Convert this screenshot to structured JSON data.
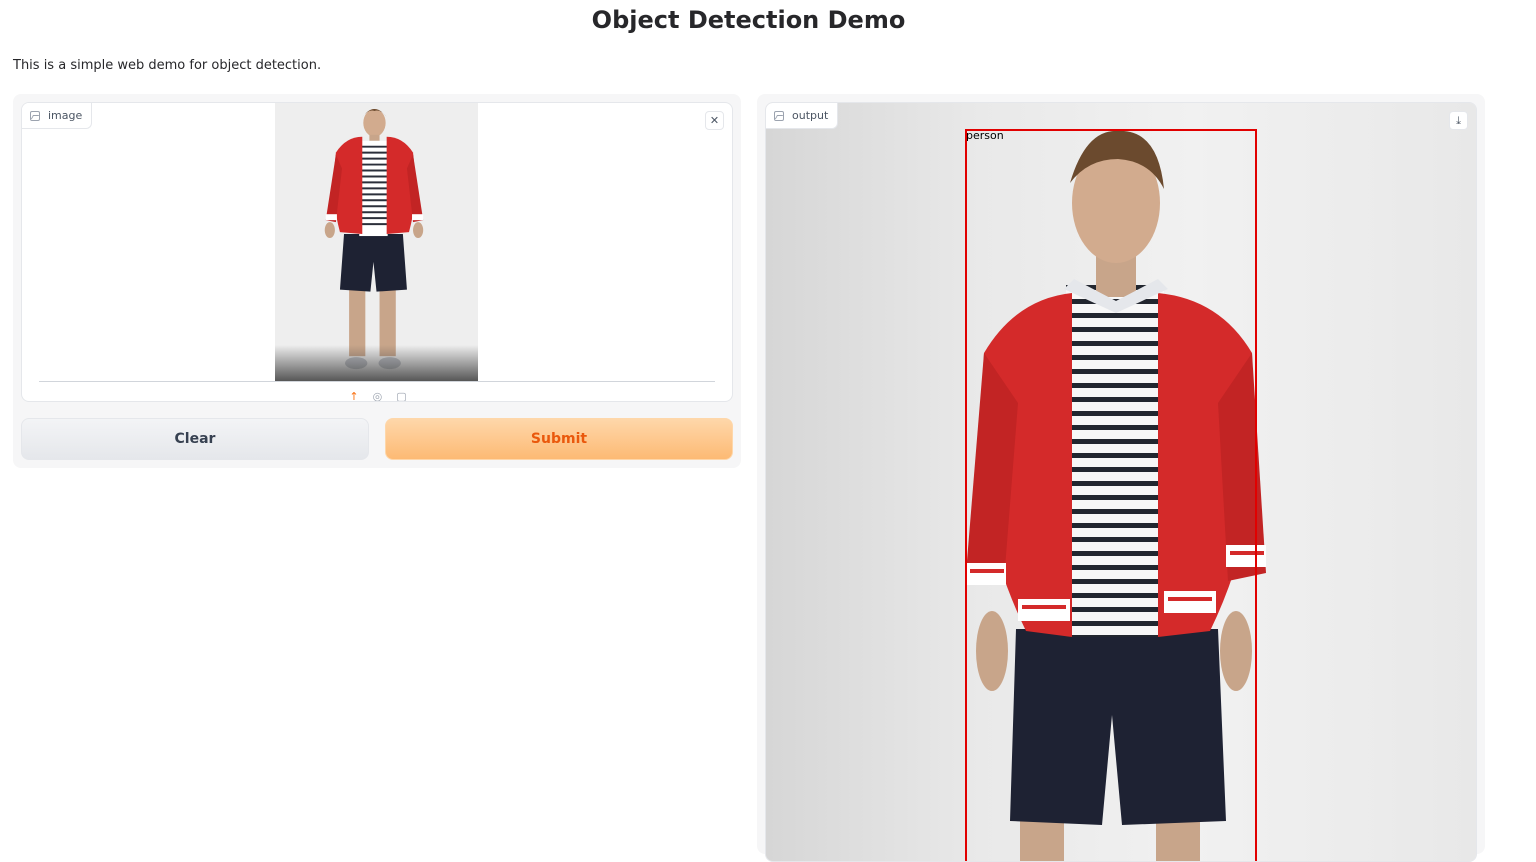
{
  "header": {
    "title": "Object Detection Demo",
    "description": "This is a simple web demo for object detection."
  },
  "input_panel": {
    "label": "image",
    "clear_image_icon": "close-icon",
    "toolbar": {
      "upload_icon": "↑",
      "webcam_icon": "◎",
      "clipboard_icon": "▢"
    }
  },
  "buttons": {
    "clear_label": "Clear",
    "submit_label": "Submit"
  },
  "output_panel": {
    "label": "output",
    "download_icon": "⤓",
    "detections": [
      {
        "label": "person"
      }
    ]
  },
  "colors": {
    "accent": "#f97316",
    "submit_text": "#ea580c",
    "detection_box": "#e10000",
    "jacket": "#d42a2a",
    "shorts": "#1e2233"
  }
}
